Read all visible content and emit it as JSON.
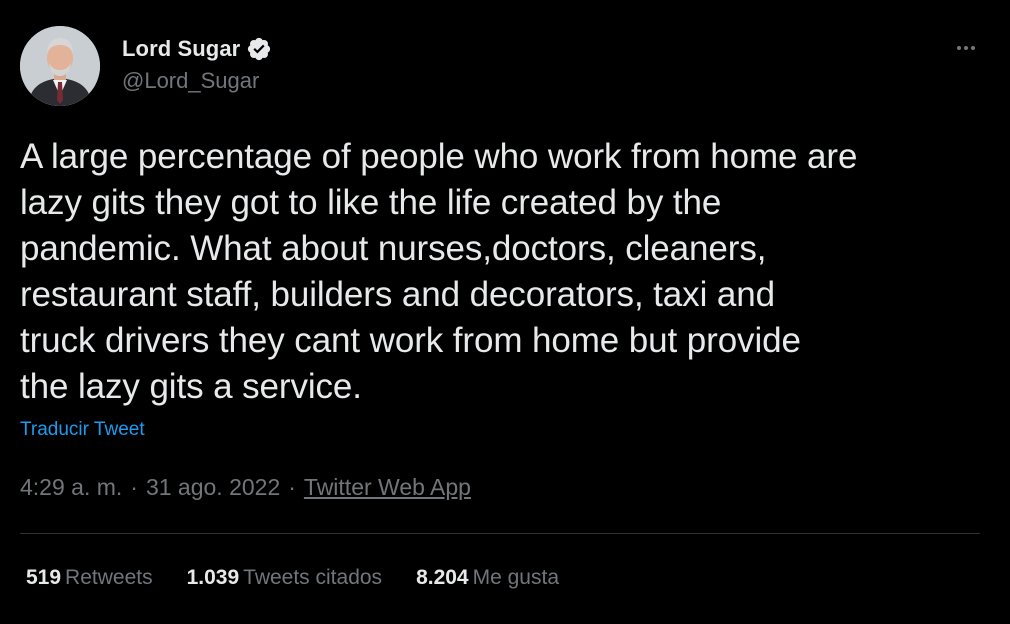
{
  "author": {
    "display_name": "Lord Sugar",
    "handle": "@Lord_Sugar",
    "verified_icon": "verified-badge-icon",
    "avatar_icon": "profile-photo"
  },
  "menu": {
    "more_icon": "more-options-icon"
  },
  "tweet": {
    "text": "A large percentage of people who work from home are\nlazy gits they got to like the life created by the\npandemic. What about nurses,doctors, cleaners,\nrestaurant staff, builders and decorators, taxi and\ntruck drivers they cant work from home but provide\nthe lazy gits a service.",
    "translate_label": "Traducir Tweet"
  },
  "meta": {
    "time": "4:29 a. m.",
    "separator": "·",
    "date": "31 ago. 2022",
    "source": "Twitter Web App"
  },
  "stats": [
    {
      "count": "519",
      "label": "Retweets"
    },
    {
      "count": "1.039",
      "label": "Tweets citados"
    },
    {
      "count": "8.204",
      "label": "Me gusta"
    }
  ],
  "colors": {
    "background": "#000000",
    "text_primary": "#e7e9ea",
    "text_secondary": "#71767b",
    "link": "#1d9bf0",
    "divider": "#2f3336"
  }
}
